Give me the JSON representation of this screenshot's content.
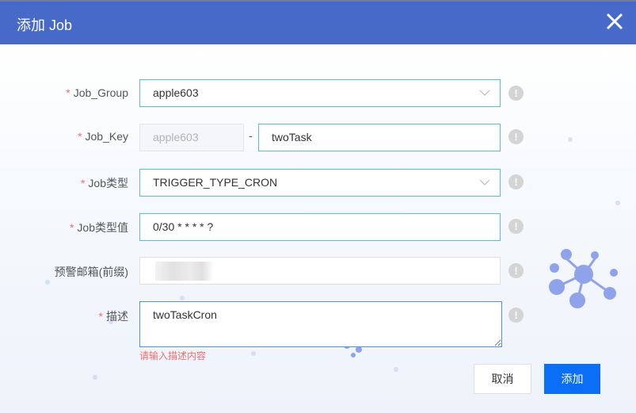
{
  "dialog": {
    "title": "添加 Job"
  },
  "form": {
    "job_group": {
      "label": "Job_Group",
      "value": "apple603"
    },
    "job_key": {
      "label": "Job_Key",
      "prefix": "apple603",
      "separator": "-",
      "value": "twoTask"
    },
    "job_type": {
      "label": "Job类型",
      "value": "TRIGGER_TYPE_CRON"
    },
    "job_type_value": {
      "label": "Job类型值",
      "value": "0/30 * * * * ?"
    },
    "alert_email": {
      "label": "预警邮箱(前缀)",
      "value": ""
    },
    "description": {
      "label": "描述",
      "value": "twoTaskCron",
      "error": "请输入描述内容"
    },
    "required_mark": "*",
    "info_glyph": "!"
  },
  "buttons": {
    "cancel": "取消",
    "add": "添加"
  },
  "colors": {
    "header": "#4769c8",
    "primary": "#0a6ef7",
    "error": "#f56c6c"
  }
}
